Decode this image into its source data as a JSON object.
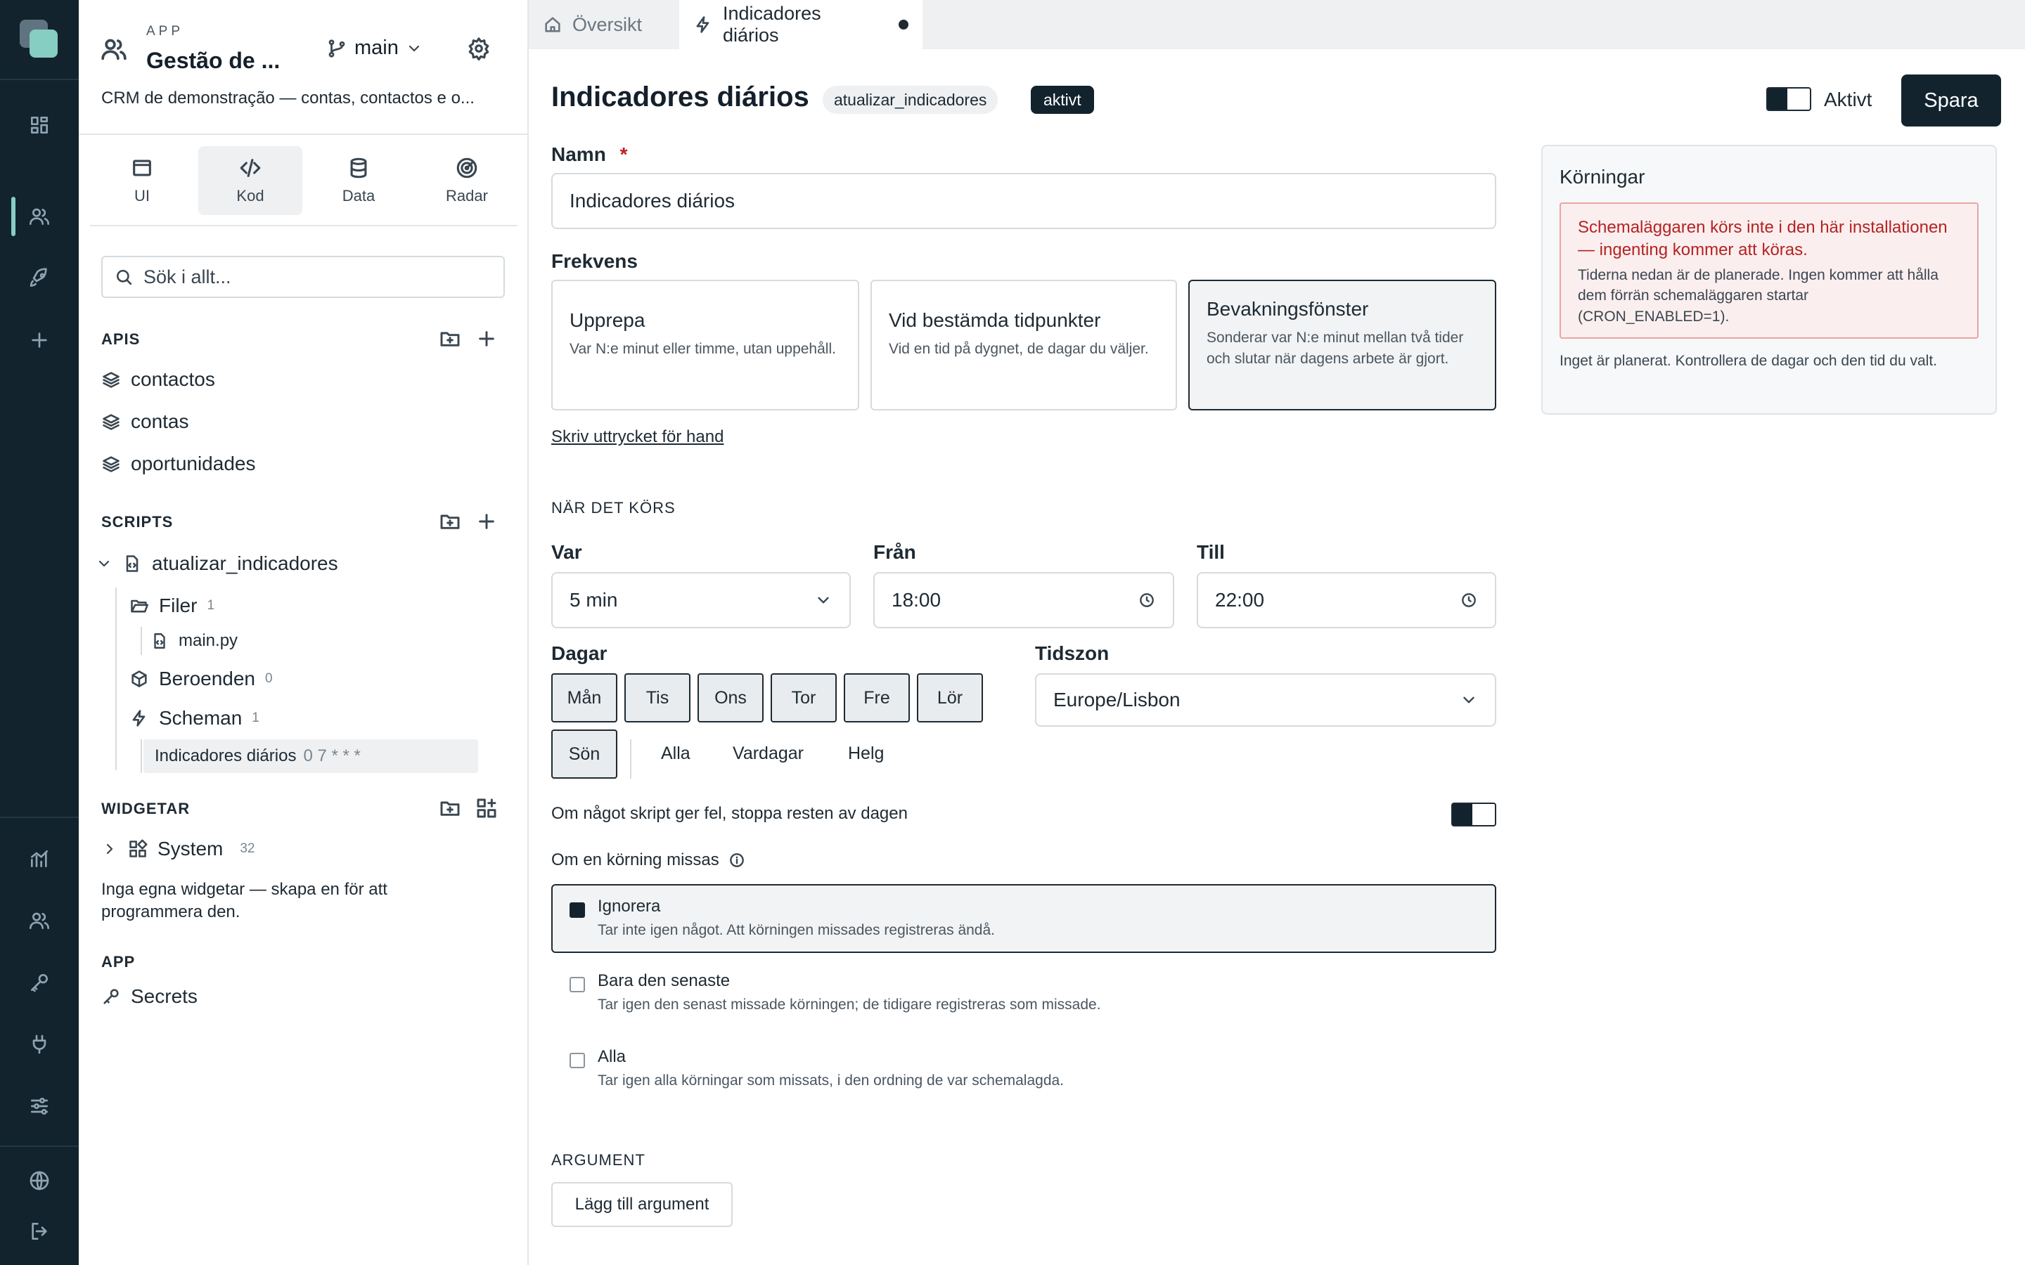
{
  "rail": {
    "icons": [
      "app-logo",
      "dashboard-icon",
      "users-icon",
      "rocket-icon",
      "plus-icon",
      "chart-icon",
      "team-icon",
      "key-icon",
      "plug-icon",
      "sliders-icon",
      "globe-icon",
      "logout-icon"
    ]
  },
  "sidebar": {
    "app_caption": "APP",
    "app_name": "Gestão de ...",
    "branch": "main",
    "app_description": "CRM de demonstração — contas, contactos e o...",
    "tabs": [
      {
        "label": "UI"
      },
      {
        "label": "Kod"
      },
      {
        "label": "Data"
      },
      {
        "label": "Radar"
      }
    ],
    "search_placeholder": "Sök i allt...",
    "apis_title": "APIS",
    "apis": [
      "contactos",
      "contas",
      "oportunidades"
    ],
    "scripts_title": "SCRIPTS",
    "script_name": "atualizar_indicadores",
    "files_label": "Filer",
    "files_count": "1",
    "file_name": "main.py",
    "deps_label": "Beroenden",
    "deps_count": "0",
    "schedules_label": "Scheman",
    "schedules_count": "1",
    "schedule_name": "Indicadores diários",
    "schedule_cron": "0 7 * * *",
    "widgets_title": "WIDGETAR",
    "system_label": "System",
    "system_count": "32",
    "widgets_empty": "Inga egna widgetar — skapa en för att programmera den.",
    "app_title": "APP",
    "secrets_label": "Secrets"
  },
  "tabbar": {
    "tabs": [
      {
        "label": "Översikt"
      },
      {
        "label": "Indicadores diários"
      }
    ]
  },
  "header": {
    "title": "Indicadores diários",
    "script_badge": "atualizar_indicadores",
    "status_badge": "aktivt",
    "active_label": "Aktivt",
    "save_label": "Spara"
  },
  "form": {
    "name_label": "Namn",
    "required_mark": "*",
    "name_value": "Indicadores diários",
    "frequency_label": "Frekvens",
    "frequency_options": [
      {
        "title": "Upprepa",
        "desc": "Var N:e minut eller timme, utan uppehåll."
      },
      {
        "title": "Vid bestämda tidpunkter",
        "desc": "Vid en tid på dygnet, de dagar du väljer."
      },
      {
        "title": "Bevakningsfönster",
        "desc": "Sonderar var N:e minut mellan två tider och slutar när dagens arbete är gjort."
      }
    ],
    "manual_link": "Skriv uttrycket för hand",
    "when_title": "NÄR DET KÖRS",
    "every_label": "Var",
    "every_value": "5 min",
    "from_label": "Från",
    "from_value": "18:00",
    "to_label": "Till",
    "to_value": "22:00",
    "days_label": "Dagar",
    "days": [
      "Mån",
      "Tis",
      "Ons",
      "Tor",
      "Fre",
      "Lör",
      "Sön"
    ],
    "quick_all": "Alla",
    "quick_weekdays": "Vardagar",
    "quick_weekend": "Helg",
    "timezone_label": "Tidszon",
    "timezone_value": "Europe/Lisbon",
    "stop_on_error_label": "Om något skript ger fel, stoppa resten av dagen",
    "missed_label": "Om en körning missas",
    "missed_options": [
      {
        "title": "Ignorera",
        "desc": "Tar inte igen något. Att körningen missades registreras ändå."
      },
      {
        "title": "Bara den senaste",
        "desc": "Tar igen den senast missade körningen; de tidigare registreras som missade."
      },
      {
        "title": "Alla",
        "desc": "Tar igen alla körningar som missats, i den ordning de var schemalagda."
      }
    ],
    "args_title": "ARGUMENT",
    "add_arg_label": "Lägg till argument"
  },
  "runs": {
    "title": "Körningar",
    "alert_title": "Schemaläggaren körs inte i den här installationen — ingenting kommer att köras.",
    "alert_body": "Tiderna nedan är de planerade. Ingen kommer att hålla dem förrän schemaläggaren startar (CRON_ENABLED=1).",
    "empty": "Inget är planerat. Kontrollera de dagar och den tid du valt."
  },
  "colors": {
    "rail_bg": "#12232e",
    "accent": "#86cdc2",
    "primary": "#12232e",
    "danger": "#b42323",
    "danger_bg": "#fbeeee"
  }
}
